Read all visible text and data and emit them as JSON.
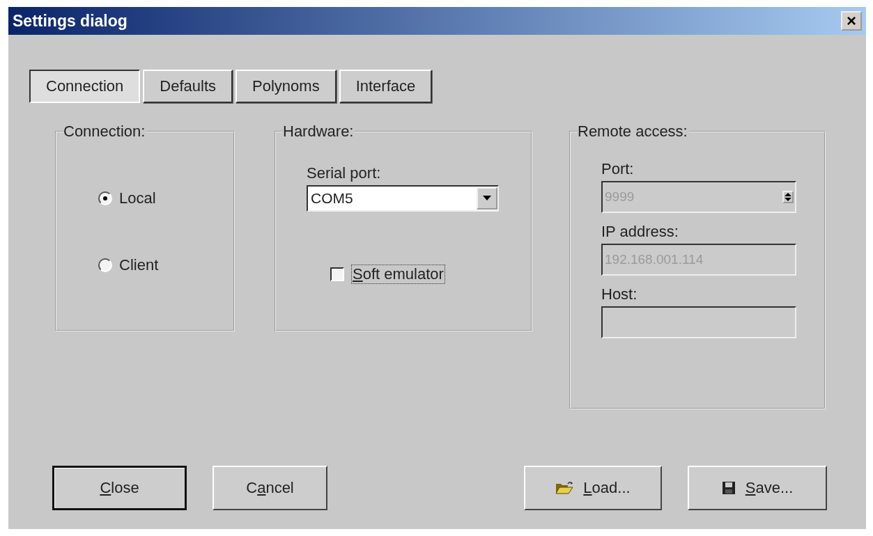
{
  "window": {
    "title": "Settings dialog",
    "close_button": "×"
  },
  "tabs": [
    {
      "label": "Connection",
      "selected": true
    },
    {
      "label": "Defaults",
      "selected": false
    },
    {
      "label": "Polynoms",
      "selected": false
    },
    {
      "label": "Interface",
      "selected": false
    }
  ],
  "connection_group": {
    "title": "Connection:",
    "options": [
      {
        "label": "Local",
        "selected": true
      },
      {
        "label": "Client",
        "selected": false
      }
    ]
  },
  "hardware_group": {
    "title": "Hardware:",
    "serial_port": {
      "label": "Serial port:",
      "value": "COM5"
    },
    "soft_emulator": {
      "label": {
        "key": "S",
        "after": "oft emulator"
      },
      "checked": false,
      "focused": true
    }
  },
  "remote_group": {
    "title": "Remote access:",
    "fields": [
      {
        "kind": "spin",
        "label": "Port:",
        "value": "9999",
        "disabled": true
      },
      {
        "kind": "text",
        "label": "IP address:",
        "value": "192.168.001.114",
        "disabled": true
      },
      {
        "kind": "text",
        "label": "Host:",
        "disabled": true
      }
    ]
  },
  "buttons": [
    {
      "kind": "plain",
      "label": {
        "key": "C",
        "after": "lose"
      },
      "default": true
    },
    {
      "kind": "plain",
      "label": {
        "before": "C",
        "key": "a",
        "after": "ncel"
      },
      "default": false
    },
    {
      "kind": "load",
      "label": {
        "key": "L",
        "after": "oad..."
      },
      "default": false
    },
    {
      "kind": "save",
      "label": {
        "key": "S",
        "after": "ave..."
      },
      "default": false
    }
  ]
}
